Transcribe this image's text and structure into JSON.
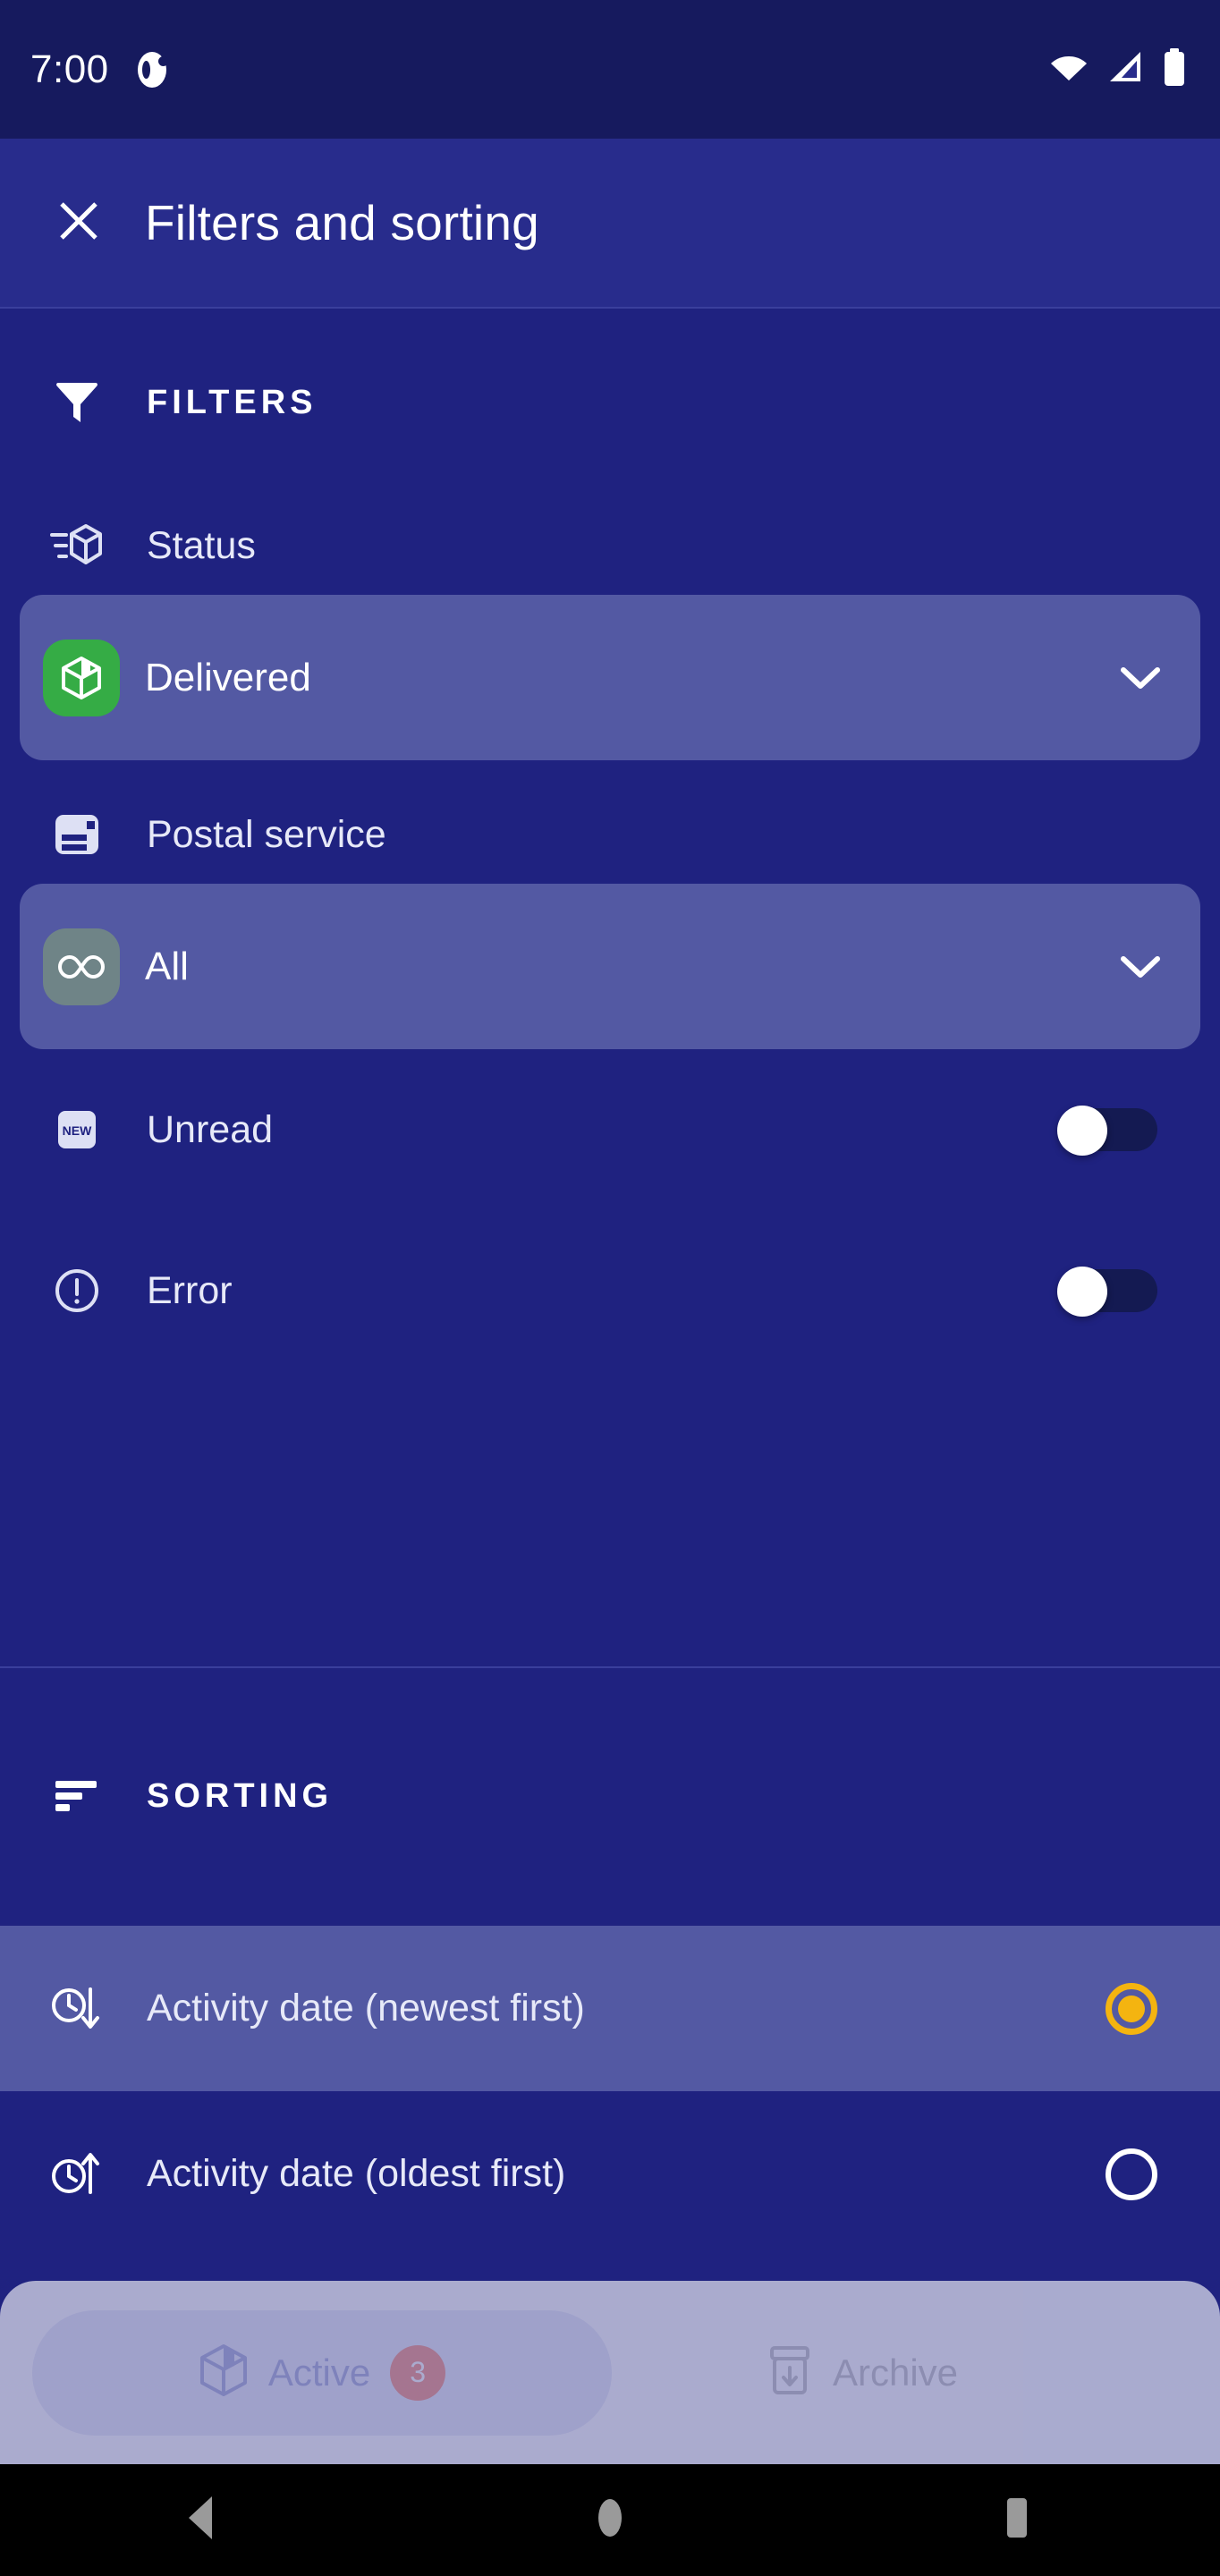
{
  "status_bar": {
    "time": "7:00",
    "notification_icon": "app-notification-icon",
    "wifi_icon": "wifi-icon",
    "signal_icon": "cellular-signal-icon",
    "battery_icon": "battery-icon"
  },
  "app_bar": {
    "close_icon": "close-icon",
    "title": "Filters and sorting"
  },
  "filters": {
    "section_icon": "funnel-icon",
    "section_label": "FILTERS",
    "status": {
      "icon": "package-status-icon",
      "label": "Status",
      "selected_value": "Delivered",
      "value_icon": "package-box-icon",
      "value_icon_color": "#35ac45",
      "chevron_icon": "chevron-down-icon"
    },
    "postal_service": {
      "icon": "postal-label-icon",
      "label": "Postal service",
      "selected_value": "All",
      "value_icon": "infinity-icon",
      "value_icon_color": "#6f8487",
      "chevron_icon": "chevron-down-icon"
    },
    "toggles": [
      {
        "icon": "new-badge-icon",
        "label": "Unread",
        "state": "off"
      },
      {
        "icon": "error-exclamation-icon",
        "label": "Error",
        "state": "off"
      }
    ]
  },
  "sorting": {
    "section_icon": "sort-descending-icon",
    "section_label": "SORTING",
    "options": [
      {
        "icon": "clock-arrow-down-icon",
        "label": "Activity date (newest first)",
        "selected": true
      },
      {
        "icon": "clock-arrow-up-icon",
        "label": "Activity date (oldest first)",
        "selected": false
      }
    ]
  },
  "bottom_nav": {
    "items": [
      {
        "icon": "package-outline-icon",
        "label": "Active",
        "badge": "3",
        "active": true
      },
      {
        "icon": "archive-box-icon",
        "label": "Archive",
        "badge": "",
        "active": false
      }
    ]
  },
  "android_nav": {
    "back_icon": "back-triangle-icon",
    "home_icon": "home-circle-icon",
    "recents_icon": "recents-square-icon"
  },
  "colors": {
    "background": "#1f2280",
    "app_bar": "#282c8c",
    "status_bar": "#161a5e",
    "highlight_row": "#5359a3",
    "accent_selected": "#f4b410",
    "delivered_green": "#35ac45",
    "badge_coral": "#f8a99b"
  }
}
